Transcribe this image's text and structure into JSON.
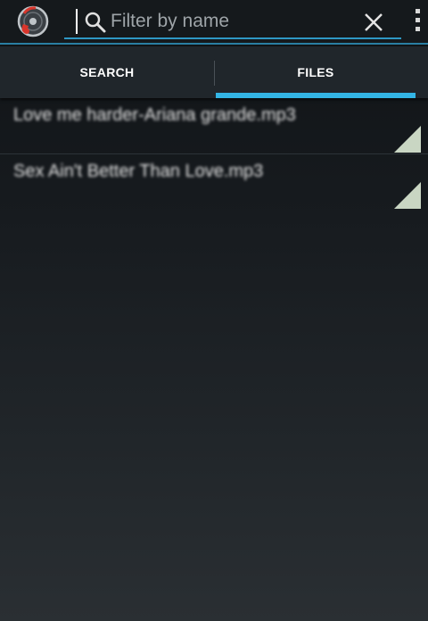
{
  "action_bar": {
    "app_icon": "music-disc-icon",
    "search": {
      "placeholder": "Filter by name",
      "value": "",
      "icon": "search-icon",
      "clear_icon": "close-icon"
    },
    "overflow_icon": "more-vertical-icon"
  },
  "tabs": [
    {
      "label": "SEARCH",
      "selected": false
    },
    {
      "label": "FILES",
      "selected": true
    }
  ],
  "files": [
    {
      "name": "Love me harder-Ariana grande.mp3"
    },
    {
      "name": "Sex Ain't Better Than Love.mp3"
    }
  ],
  "colors": {
    "accent": "#33b5e5",
    "marker": "#c9d6c3",
    "app_icon_red": "#d9352b"
  }
}
